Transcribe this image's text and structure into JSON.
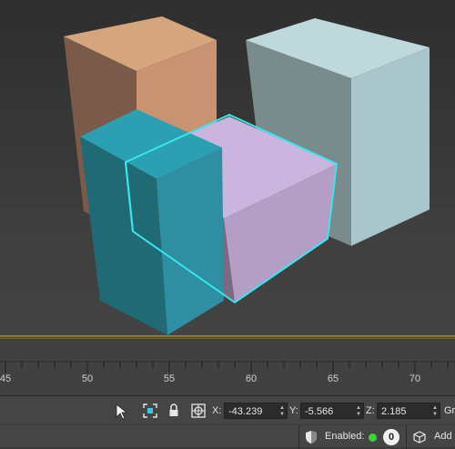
{
  "viewport": {
    "colors": {
      "background_top": "#2f2f2f",
      "background_mid": "#3c3c3c",
      "background_bottom": "#454545",
      "selection_outline": "#38e6ee"
    },
    "objects": [
      {
        "name": "orange-box",
        "color": "#d6a07a"
      },
      {
        "name": "pale-blue-box",
        "color": "#a9c5cb"
      },
      {
        "name": "teal-box",
        "color": "#2b95a6"
      },
      {
        "name": "lavender-box",
        "color": "#c1aad6",
        "selected": true
      }
    ]
  },
  "timeline": {
    "labels": [
      "45",
      "50",
      "55",
      "60",
      "65",
      "70"
    ]
  },
  "statusbar": {
    "x_label": "X:",
    "x_value": "-43.239",
    "y_label": "Y:",
    "y_value": "-5.566",
    "z_label": "Z:",
    "z_value": "2.185",
    "grid_label": "Gri",
    "enabled_label": "Enabled:",
    "enabled_count": "0",
    "add_label": "Add",
    "status_color": "#3cd23c",
    "icons": [
      "pointer-cursor-icon",
      "selection-lock-icon",
      "padlock-icon",
      "absolute-mode-icon",
      "shield-icon",
      "cube-icon"
    ]
  }
}
